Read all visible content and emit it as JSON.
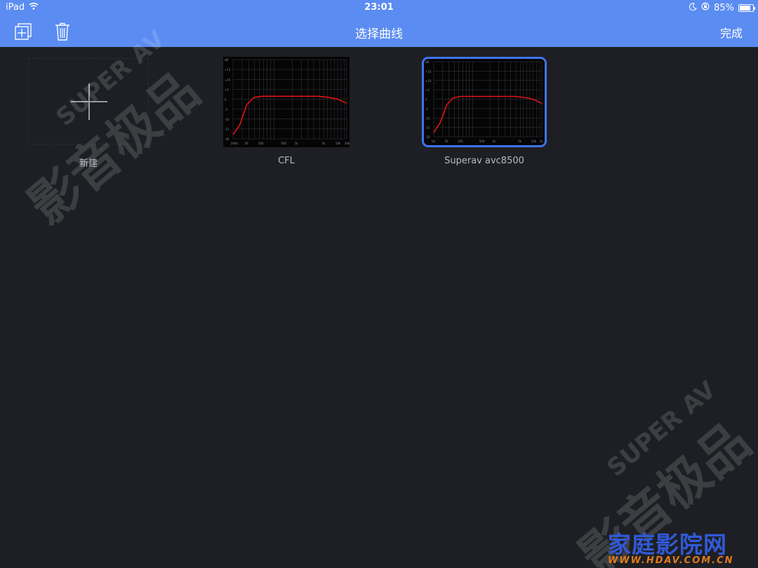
{
  "status_bar": {
    "device": "iPad",
    "time": "23:01",
    "battery_percent": "85%",
    "battery_level": 0.85
  },
  "nav": {
    "title": "选择曲线",
    "done_label": "完成",
    "left_icons": [
      "duplicate-icon",
      "trash-icon"
    ]
  },
  "tiles": [
    {
      "label": "新建",
      "icon": "plus-icon"
    },
    {
      "label": "CFL"
    },
    {
      "label": "Superav avc8500",
      "selected": true
    }
  ],
  "graph_axis": {
    "y_ticks": [
      "dB",
      "+15",
      "+10",
      "+5",
      "0",
      "-5",
      "-10",
      "-15",
      "-20"
    ],
    "x_ticks_cfl": [
      "20Hz",
      "50",
      "100",
      "500",
      "1k",
      "5k",
      "10k",
      "20k"
    ],
    "x_ticks_avc": [
      "Hz",
      "50",
      "100",
      "500",
      "1k",
      "5k",
      "10k",
      "2k"
    ]
  },
  "watermark": {
    "text_main": "影音极品",
    "text_sub": "SUPER AV"
  },
  "brand": {
    "name": "家庭影院网",
    "url": "WWW.HDAV.COM.CN"
  },
  "colors": {
    "accent": "#5b8cf2",
    "selection": "#3f74ee",
    "curve": "#e01414"
  }
}
